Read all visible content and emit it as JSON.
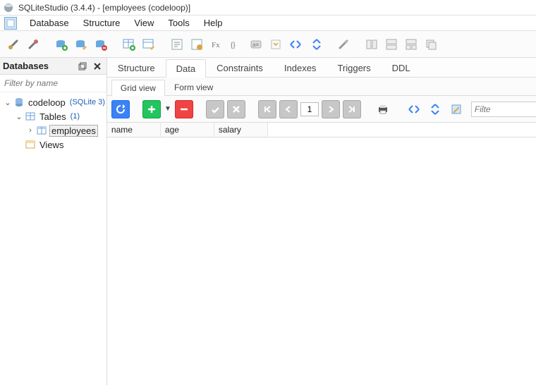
{
  "title": "SQLiteStudio (3.4.4) - [employees (codeloop)]",
  "menu": {
    "database": "Database",
    "structure": "Structure",
    "view": "View",
    "tools": "Tools",
    "help": "Help"
  },
  "leftpanel": {
    "title": "Databases",
    "filter_placeholder": "Filter by name"
  },
  "tree": {
    "db": {
      "name": "codeloop",
      "tag": "(SQLite 3)"
    },
    "tables": {
      "label": "Tables",
      "count": "(1)"
    },
    "table0": "employees",
    "views": "Views"
  },
  "tabs": {
    "structure": "Structure",
    "data": "Data",
    "constraints": "Constraints",
    "indexes": "Indexes",
    "triggers": "Triggers",
    "ddl": "DDL"
  },
  "subtabs": {
    "grid": "Grid view",
    "form": "Form view"
  },
  "pager": {
    "value": "1"
  },
  "datafilter_placeholder": "Filte",
  "columns": {
    "c0": "name",
    "c1": "age",
    "c2": "salary"
  }
}
